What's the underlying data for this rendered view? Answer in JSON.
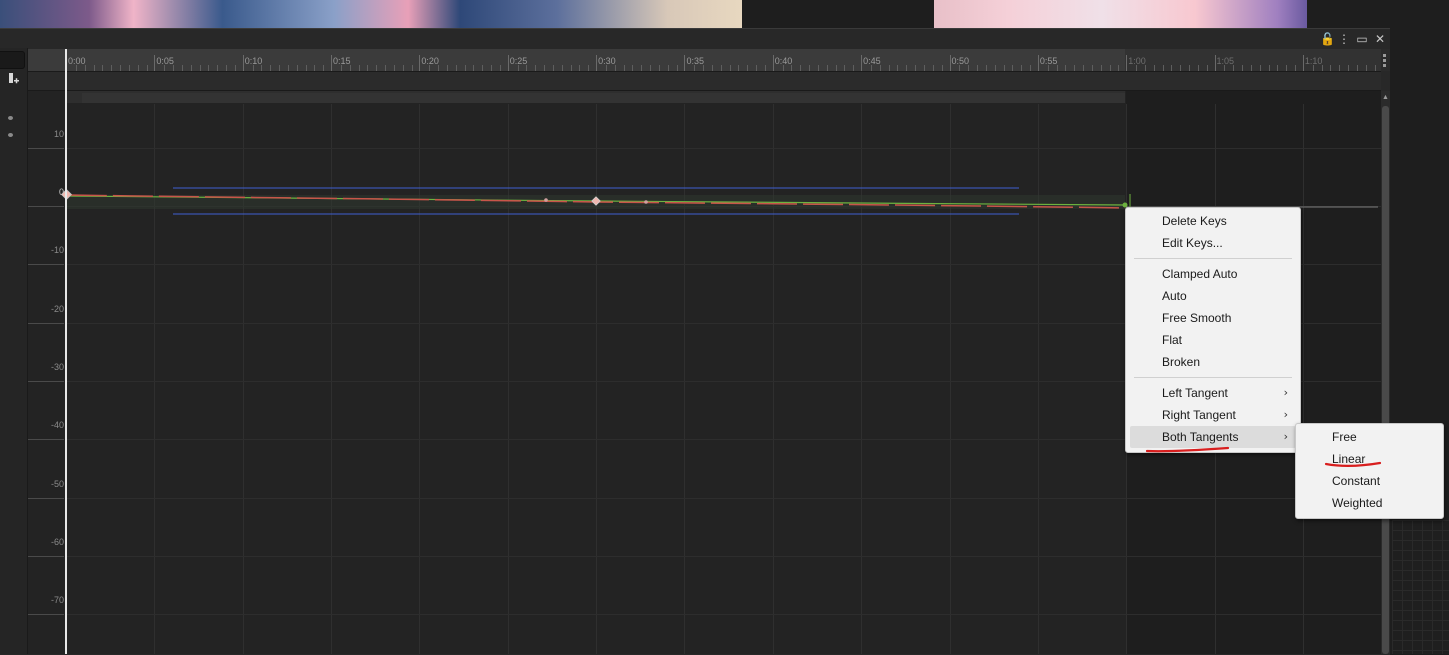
{
  "window": {
    "controls": {
      "lock": "🔓",
      "menu": "⋮",
      "maximize": "▭",
      "close": "✕"
    }
  },
  "timeline": {
    "ruler_labels": [
      "0:00",
      "0:05",
      "0:10",
      "0:15",
      "0:20",
      "0:25",
      "0:30",
      "0:35",
      "0:40",
      "0:45",
      "0:50",
      "0:55",
      "1:00",
      "1:05",
      "1:10"
    ],
    "y_labels": [
      "10",
      "0",
      "-10",
      "-20",
      "-30",
      "-40",
      "-50",
      "-60",
      "-70"
    ]
  },
  "curve_editor": {
    "add_key_icon": "add-keyframe-icon",
    "colors": {
      "curve_red": "#c8554a",
      "curve_green": "#6db33f",
      "bounds_blue": "#3f5fd0",
      "key_highlight": "#f0b8b0"
    }
  },
  "context_menu": {
    "items": [
      {
        "label": "Delete Keys"
      },
      {
        "label": "Edit Keys..."
      },
      {
        "label": "Clamped Auto"
      },
      {
        "label": "Auto"
      },
      {
        "label": "Free Smooth"
      },
      {
        "label": "Flat"
      },
      {
        "label": "Broken"
      },
      {
        "label": "Left Tangent",
        "submenu": true
      },
      {
        "label": "Right Tangent",
        "submenu": true
      },
      {
        "label": "Both Tangents",
        "submenu": true,
        "highlighted": true
      }
    ],
    "submenu_arrow": "›"
  },
  "submenu": {
    "items": [
      {
        "label": "Free"
      },
      {
        "label": "Linear"
      },
      {
        "label": "Constant"
      },
      {
        "label": "Weighted"
      }
    ]
  }
}
